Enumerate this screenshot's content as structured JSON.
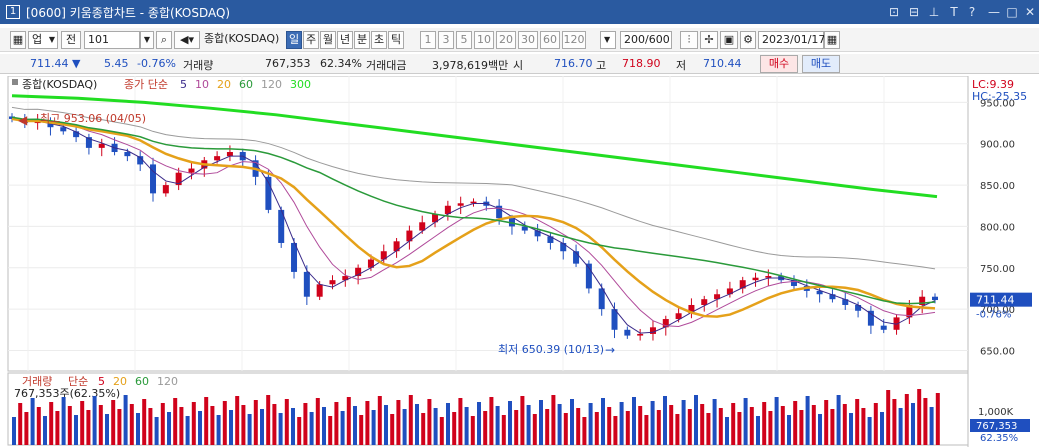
{
  "window": {
    "number": "1",
    "title": "[0600] 키움종합차트 - 종합(KOSDAQ)",
    "buttons": [
      "⊡",
      "⊟",
      "⊥",
      "T",
      "?",
      "—",
      "□",
      "✕"
    ]
  },
  "toolbar": {
    "market_select": "업",
    "prev_label": "전",
    "code": "101",
    "name": "종합(KOSDAQ)",
    "periods": [
      {
        "label": "일",
        "active": true
      },
      {
        "label": "주",
        "active": false
      },
      {
        "label": "월",
        "active": false
      },
      {
        "label": "년",
        "active": false
      },
      {
        "label": "분",
        "active": false
      },
      {
        "label": "초",
        "active": false
      },
      {
        "label": "틱",
        "active": false
      }
    ],
    "intervals": [
      "1",
      "3",
      "5",
      "10",
      "20",
      "30",
      "60",
      "120"
    ],
    "count": "200/600",
    "date": "2023/01/17"
  },
  "quote": {
    "price": "711.44",
    "arrow": "▼",
    "change": "5.45",
    "change_pct": "-0.76%",
    "volume_label": "거래량",
    "volume": "767,353",
    "volume_pct": "62.34%",
    "amount_label": "거래대금",
    "amount": "3,978,619백만",
    "open_label": "시",
    "open": "716.70",
    "high_label": "고",
    "high": "718.90",
    "low_label": "저",
    "low": "710.44",
    "buy_label": "매수",
    "sell_label": "매도"
  },
  "colors": {
    "up": "#d0021b",
    "down": "#1f4fbf",
    "ma5": "#3a2a8a",
    "ma10": "#b04a9a",
    "ma20": "#e5a11a",
    "ma60": "#2a9a3a",
    "ma120": "#9a9a9a",
    "ma300": "#22dd22"
  },
  "price_legend": {
    "name": "종합(KOSDAQ)",
    "prefix": "종가 단순",
    "periods": [
      "5",
      "10",
      "20",
      "60",
      "120",
      "300"
    ]
  },
  "volume_legend": {
    "name": "거래량",
    "prefix": "단순",
    "periods": [
      "5",
      "20",
      "60",
      "120"
    ],
    "value": "767,353주(62.35%)"
  },
  "right_info": {
    "lc": "LC:9.39",
    "hc": "HC:-25.35",
    "price_tag": "711.44",
    "pct_tag": "-0.76%",
    "vol_axis": "1,000K",
    "vol_tag": "767,353",
    "vol_pct": "62.35%"
  },
  "annotations": {
    "high": "최고 953.06 (04/05)",
    "low": "최저 650.39 (10/13)"
  },
  "chart_data": {
    "type": "candlestick",
    "title": "종합(KOSDAQ)",
    "y_ticks": [
      "950.00",
      "900.00",
      "850.00",
      "800.00",
      "750.00",
      "700.00",
      "650.00"
    ],
    "ylim": [
      630,
      965
    ],
    "high": 953.06,
    "low": 650.39,
    "last": 711.44,
    "close_series": [
      930,
      925,
      928,
      920,
      915,
      908,
      895,
      900,
      890,
      885,
      875,
      840,
      850,
      865,
      870,
      880,
      885,
      890,
      880,
      860,
      820,
      780,
      745,
      715,
      730,
      735,
      740,
      750,
      760,
      770,
      782,
      795,
      805,
      815,
      825,
      828,
      830,
      825,
      810,
      800,
      795,
      788,
      780,
      770,
      755,
      725,
      700,
      675,
      668,
      670,
      678,
      688,
      695,
      705,
      712,
      718,
      725,
      735,
      738,
      740,
      735,
      728,
      722,
      718,
      712,
      705,
      698,
      680,
      675,
      690,
      705,
      715,
      711
    ],
    "ma300_series": [
      958,
      955,
      950,
      943,
      935,
      925,
      915,
      905,
      895,
      885,
      875,
      865,
      855,
      845,
      836
    ]
  }
}
